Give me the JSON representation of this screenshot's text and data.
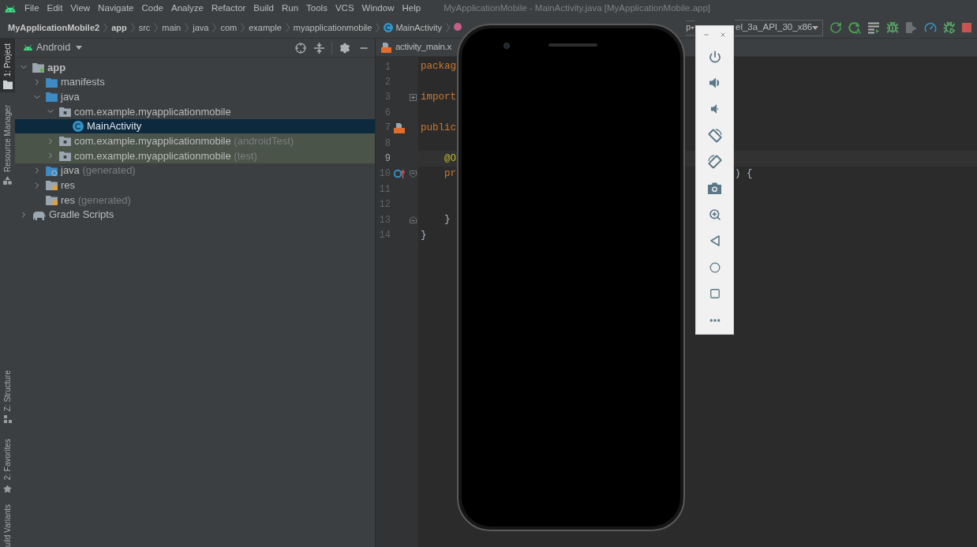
{
  "menu_bar": {
    "items": [
      "File",
      "Edit",
      "View",
      "Navigate",
      "Code",
      "Analyze",
      "Refactor",
      "Build",
      "Run",
      "Tools",
      "VCS",
      "Window",
      "Help"
    ],
    "title": "MyApplicationMobile - MainActivity.java [MyApplicationMobile.app]"
  },
  "breadcrumb": [
    {
      "label": "MyApplicationMobile2",
      "kind": "project"
    },
    {
      "label": "app",
      "kind": "module"
    },
    {
      "label": "src",
      "kind": "folder"
    },
    {
      "label": "main",
      "kind": "folder"
    },
    {
      "label": "java",
      "kind": "folder"
    },
    {
      "label": "com",
      "kind": "folder"
    },
    {
      "label": "example",
      "kind": "folder"
    },
    {
      "label": "myapplicationmobile",
      "kind": "folder"
    },
    {
      "label": "MainActivity",
      "kind": "class"
    },
    {
      "kind": "method"
    }
  ],
  "run_toolbar": {
    "configuration": {
      "value": "p"
    },
    "device": {
      "value": "el_3a_API_30_x86"
    },
    "buttons": [
      {
        "kind": "rerun",
        "disabled": false
      },
      {
        "kind": "apply-code-changes",
        "disabled": false
      },
      {
        "kind": "apply-changes",
        "disabled": false
      },
      {
        "kind": "debug",
        "disabled": false
      },
      {
        "kind": "attach-debugger",
        "disabled": true
      },
      {
        "kind": "profile",
        "disabled": false
      },
      {
        "kind": "attach",
        "disabled": false
      },
      {
        "kind": "stop",
        "disabled": false
      }
    ]
  },
  "left_strip": {
    "top": [
      {
        "label": "1: Project",
        "kind": "project",
        "selected": true
      },
      {
        "label": "Resource Manager",
        "kind": "resources",
        "selected": false
      }
    ],
    "bottom": [
      {
        "label": "Z: Structure",
        "kind": "structure",
        "selected": false
      },
      {
        "label": "2: Favorites",
        "kind": "favorites",
        "selected": false
      },
      {
        "label": "uild Variants",
        "kind": "variants",
        "selected": false
      }
    ]
  },
  "project_panel": {
    "view": "Android",
    "tree": [
      {
        "label": "app",
        "kind": "module",
        "expanded": true,
        "selected": false,
        "children": [
          {
            "label": "manifests",
            "kind": "folder",
            "expanded": false,
            "selected": false
          },
          {
            "label": "java",
            "kind": "folder",
            "expanded": true,
            "selected": false,
            "children": [
              {
                "label": "com.example.myapplicationmobile",
                "kind": "package",
                "expanded": true,
                "selected": false,
                "children": [
                  {
                    "label": "MainActivity",
                    "kind": "class",
                    "selected": true
                  }
                ]
              },
              {
                "label": "com.example.myapplicationmobile",
                "suffix": "(androidTest)",
                "kind": "test-package",
                "expanded": false,
                "selected": false
              },
              {
                "label": "com.example.myapplicationmobile",
                "suffix": "(test)",
                "kind": "test-package",
                "expanded": false,
                "selected": false
              }
            ]
          },
          {
            "label": "java",
            "suffix": "(generated)",
            "kind": "generated-folder",
            "expanded": false,
            "selected": false
          },
          {
            "label": "res",
            "kind": "res-folder",
            "expanded": false,
            "selected": false
          },
          {
            "label": "res",
            "suffix": "(generated)",
            "kind": "res-folder",
            "selected": false
          }
        ]
      },
      {
        "label": "Gradle Scripts",
        "kind": "gradle",
        "expanded": false,
        "selected": false
      }
    ]
  },
  "editor": {
    "tabs": [
      {
        "label": "activity_main.x",
        "kind": "xml",
        "selected": false
      }
    ],
    "lines": [
      {
        "number": "1",
        "code": "packag",
        "kind": "keyword",
        "current": false
      },
      {
        "number": "2",
        "current": false
      },
      {
        "number": "3",
        "code": "import",
        "kind": "keyword",
        "fold": {
          "kind": "collapsed"
        },
        "current": false
      },
      {
        "number": "6",
        "current": false
      },
      {
        "number": "7",
        "code": "public",
        "kind": "keyword",
        "marker": {
          "kind": "layout"
        },
        "current": false
      },
      {
        "number": "8",
        "current": false
      },
      {
        "number": "9",
        "code": "    @O",
        "kind": "annotation",
        "current": true
      },
      {
        "number": "10",
        "code": "    pr",
        "kind": "keyword",
        "marker": {
          "kind": "override"
        },
        "fold": {
          "kind": "open"
        },
        "tail": ") {",
        "current": false
      },
      {
        "number": "11",
        "current": false
      },
      {
        "number": "12",
        "current": false
      },
      {
        "number": "13",
        "code": "    }",
        "kind": "plain",
        "fold": {
          "kind": "close"
        },
        "current": false
      },
      {
        "number": "14",
        "code": "}",
        "kind": "plain",
        "current": false
      }
    ]
  },
  "emulator": {
    "window_controls": [
      {
        "kind": "minimize"
      },
      {
        "kind": "close"
      }
    ],
    "buttons": [
      {
        "kind": "power"
      },
      {
        "kind": "volume-up"
      },
      {
        "kind": "volume-down"
      },
      {
        "kind": "rotate-left"
      },
      {
        "kind": "rotate-right"
      },
      {
        "kind": "screenshot"
      },
      {
        "kind": "zoom"
      },
      {
        "kind": "back"
      },
      {
        "kind": "home"
      },
      {
        "kind": "overview"
      },
      {
        "kind": "more"
      }
    ]
  }
}
